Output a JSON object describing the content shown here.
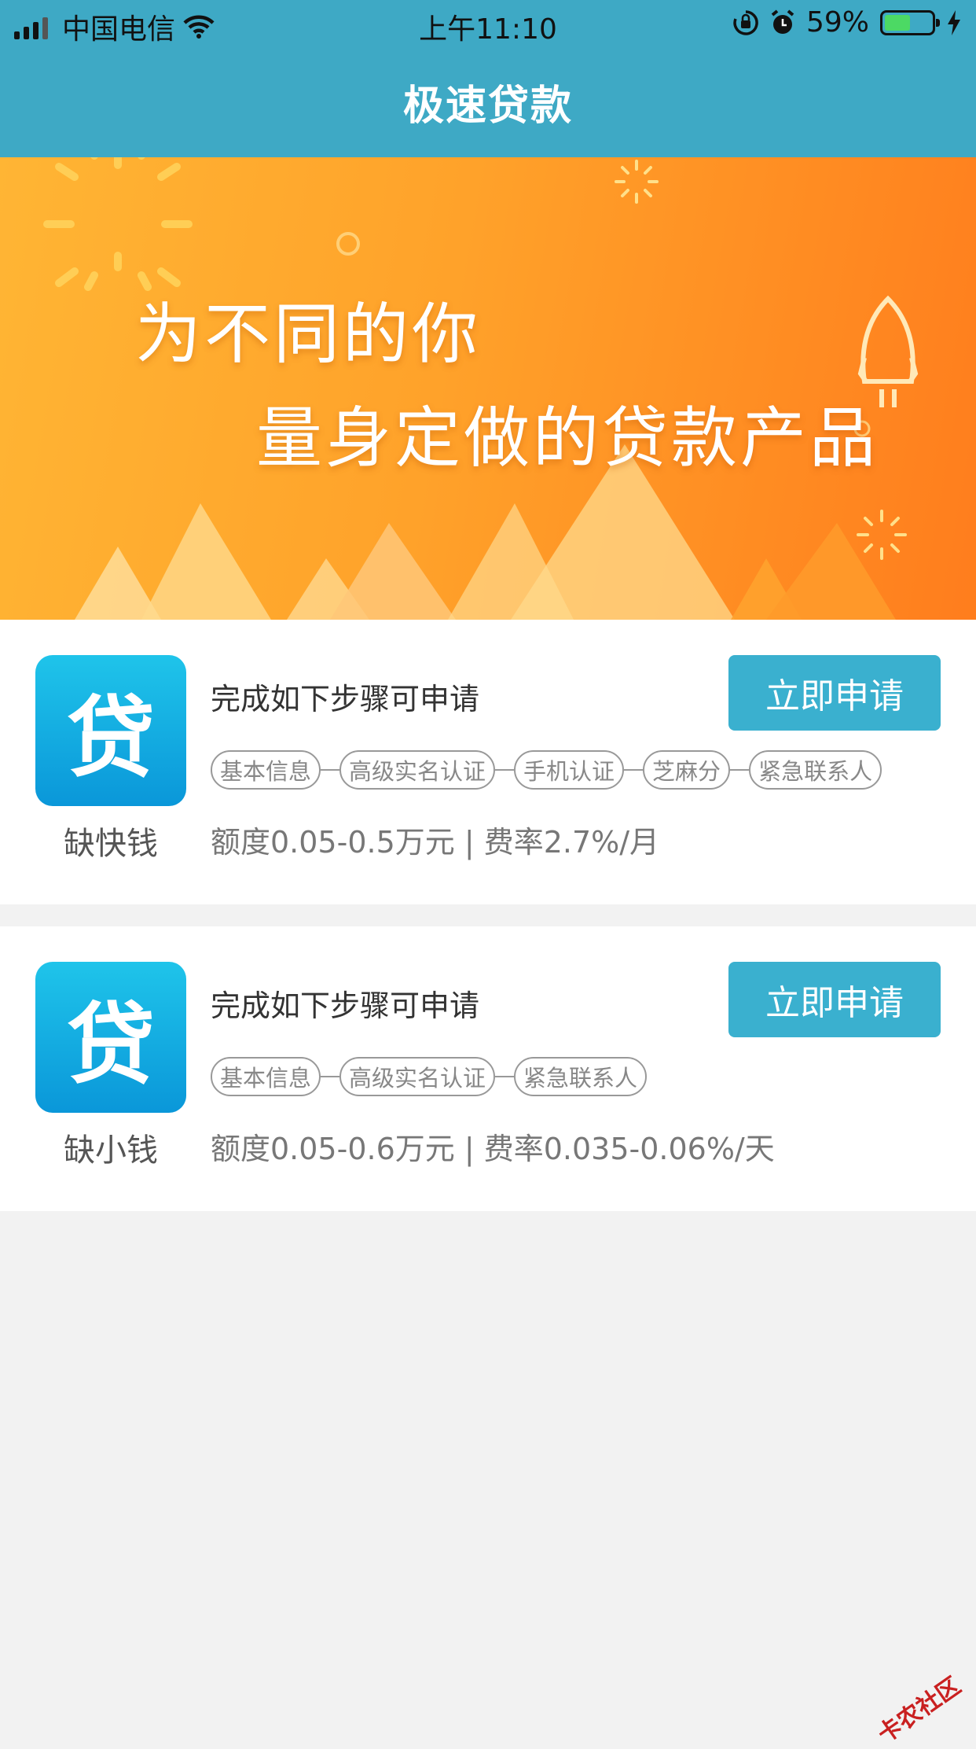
{
  "status_bar": {
    "carrier": "中国电信",
    "time": "上午11:10",
    "battery_percent": "59%",
    "battery_level": 0.59
  },
  "nav": {
    "title": "极速贷款"
  },
  "banner": {
    "line1": "为不同的你",
    "line2": "量身定做的贷款产品"
  },
  "products": [
    {
      "logo_char": "贷",
      "steps_title": "完成如下步骤可申请",
      "apply_label": "立即申请",
      "steps": [
        "基本信息",
        "高级实名认证",
        "手机认证",
        "芝麻分",
        "紧急联系人"
      ],
      "name": "缺快钱",
      "info": "额度0.05-0.5万元 | 费率2.7%/月"
    },
    {
      "logo_char": "贷",
      "steps_title": "完成如下步骤可申请",
      "apply_label": "立即申请",
      "steps": [
        "基本信息",
        "高级实名认证",
        "紧急联系人"
      ],
      "name": "缺小钱",
      "info": "额度0.05-0.6万元 | 费率0.035-0.06%/天"
    }
  ],
  "watermark": "卡农社区",
  "colors": {
    "nav_bg": "#3ea9c5",
    "apply_button": "#3ab0cf",
    "logo_gradient_top": "#1fc4ea",
    "logo_gradient_bottom": "#0a97d9",
    "banner_orange": "#ffa22a"
  }
}
